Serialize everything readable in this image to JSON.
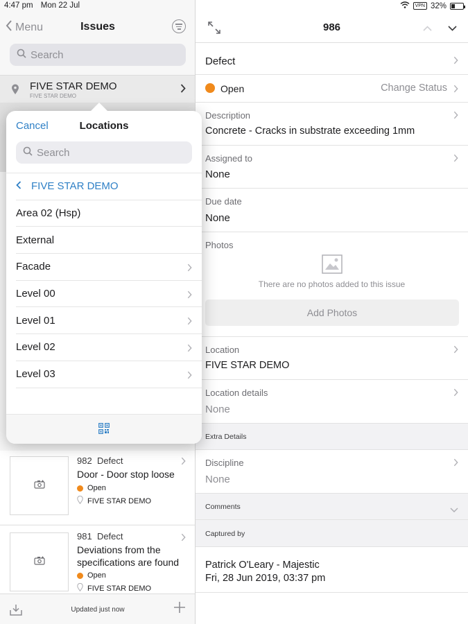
{
  "status_bar": {
    "time": "4:47 pm",
    "date": "Mon 22 Jul",
    "vpn": "VPN",
    "battery": "32%"
  },
  "left": {
    "back_label": "Menu",
    "title": "Issues",
    "search_placeholder": "Search",
    "location_header": {
      "name": "FIVE STAR DEMO",
      "sub": "FIVE STAR DEMO"
    },
    "issues": [
      {
        "number": "982",
        "type": "Defect",
        "title": "Door - Door stop loose",
        "status": "Open",
        "location": "FIVE STAR DEMO"
      },
      {
        "number": "981",
        "type": "Defect",
        "title": "Deviations from the specifications are  found",
        "status": "Open",
        "location": "FIVE STAR DEMO"
      }
    ],
    "footer_text": "Updated just now"
  },
  "popover": {
    "cancel_label": "Cancel",
    "title": "Locations",
    "search_placeholder": "Search",
    "parent": "FIVE STAR DEMO",
    "items": [
      {
        "label": "Area 02 (Hsp)"
      },
      {
        "label": "External"
      },
      {
        "label": "Facade"
      },
      {
        "label": "Level 00"
      },
      {
        "label": "Level 01"
      },
      {
        "label": "Level 02"
      },
      {
        "label": "Level 03"
      }
    ]
  },
  "detail": {
    "title": "986",
    "type": "Defect",
    "status": "Open",
    "change_status_label": "Change Status",
    "description_label": "Description",
    "description": "Concrete - Cracks in substrate exceeding 1mm",
    "assigned_label": "Assigned to",
    "assigned": "None",
    "due_label": "Due date",
    "due": "None",
    "photos_label": "Photos",
    "no_photos": "There are no photos added to this issue",
    "add_photos_label": "Add Photos",
    "location_label": "Location",
    "location": "FIVE STAR DEMO",
    "location_details_label": "Location details",
    "location_details": "None",
    "extra_details_label": "Extra Details",
    "discipline_label": "Discipline",
    "discipline": "None",
    "comments_label": "Comments",
    "captured_label": "Captured by",
    "captured_name": "Patrick O'Leary - Majestic",
    "captured_date": "Fri, 28 Jun 2019, 03:37 pm"
  },
  "colors": {
    "accent": "#2f80c6",
    "status_open": "#f08a1c"
  }
}
